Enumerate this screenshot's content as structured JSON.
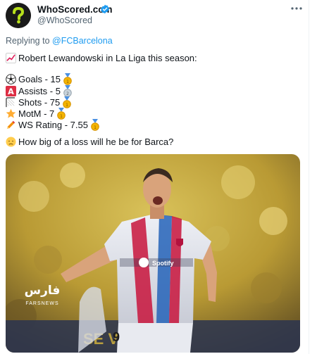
{
  "account": {
    "name": "WhoScored.com",
    "handle": "@WhoScored",
    "avatar_icon": "question-mark-logo",
    "verified_color": "#1d9bf0"
  },
  "reply": {
    "prefix": "Replying to ",
    "mention": "@FCBarcelona"
  },
  "tweet": {
    "headline": "Robert Lewandowski in La Liga this season:",
    "stats": [
      {
        "icon": "soccer-ball-icon",
        "text": "Goals - 15",
        "medal": "gold"
      },
      {
        "icon": "letter-a-icon",
        "text": "Assists - 5",
        "medal": "silver"
      },
      {
        "icon": "goal-net-icon",
        "text": "Shots - 75",
        "medal": "gold"
      },
      {
        "icon": "star-icon",
        "text": "MotM - 7",
        "medal": "gold"
      },
      {
        "icon": "pencil-icon",
        "text": "WS Rating - 7.55",
        "medal": "gold"
      }
    ],
    "question": "How big of a loss will he be for Barca?"
  },
  "media": {
    "watermark_farsi": "فارس",
    "watermark_en": "FARSNEWS",
    "jersey_number": "9",
    "sponsor": "Spotify"
  },
  "colors": {
    "accent": "#1d9bf0",
    "secondary_text": "#536471",
    "gold": "#f4b400",
    "silver": "#9aa7b0"
  }
}
